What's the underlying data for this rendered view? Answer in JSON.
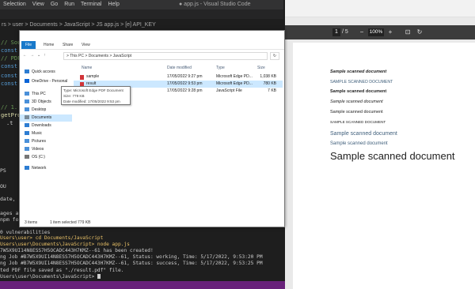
{
  "vscode": {
    "menu": [
      "Selection",
      "View",
      "Go",
      "Run",
      "Terminal",
      "Help"
    ],
    "window_title": "● app.js - Visual Studio Code",
    "breadcrumb": "rs > user > Documents > JavaScript > JS app.js > [e] API_KEY",
    "code_lines": [
      "// Sou",
      "const",
      "// PDF",
      "const",
      "const",
      "const",
      "// 1.",
      "getPro",
      ".t"
    ],
    "left_snippets": [
      "PS",
      "OU",
      "date, a",
      "ages an",
      "npm fo"
    ],
    "terminal": {
      "lines": [
        "0 vulnerabilities",
        "Users\\user> cd Documents/JavaScript",
        "Users\\user\\Documents\\JavaScript> node app.js",
        "7W5X9UI14N8ESS7H5OCADC443H7KMZ--61 has been created!",
        "ng Job #B7W5X9UI14N8ESS7H5OCADC443H7KMZ--61, Status: working, Time: 5/17/2022, 9:53:20 PM",
        "ng Job #B7W5X9UI14N8ESS7H5OCADC443H7KMZ--61, Status: success, Time: 5/17/2022, 9:53:25 PM",
        "ted PDF file saved as \"./result.pdf\" file.",
        "Users\\user\\Documents\\JavaScript> "
      ]
    }
  },
  "explorer": {
    "ribbon": {
      "file": "File",
      "tabs": [
        "Home",
        "Share",
        "View"
      ]
    },
    "address": "> This PC > Documents > JavaScript",
    "nav_items": [
      {
        "label": "Quick access",
        "icon": "star-icon",
        "color": "#2d7dd2"
      },
      {
        "label": "OneDrive - Personal",
        "icon": "cloud-icon",
        "color": "#0a64d6"
      },
      {
        "label": "This PC",
        "icon": "computer-icon",
        "color": "#4a90d9"
      },
      {
        "label": "3D Objects",
        "icon": "cube-icon",
        "color": "#4a90d9"
      },
      {
        "label": "Desktop",
        "icon": "desktop-icon",
        "color": "#4a90d9"
      },
      {
        "label": "Documents",
        "icon": "documents-icon",
        "color": "#7a8b99"
      },
      {
        "label": "Downloads",
        "icon": "download-icon",
        "color": "#2d7dd2"
      },
      {
        "label": "Music",
        "icon": "music-icon",
        "color": "#2d7dd2"
      },
      {
        "label": "Pictures",
        "icon": "pictures-icon",
        "color": "#4a90d9"
      },
      {
        "label": "Videos",
        "icon": "video-icon",
        "color": "#4a90d9"
      },
      {
        "label": "OS (C:)",
        "icon": "drive-icon",
        "color": "#777777"
      },
      {
        "label": "Network",
        "icon": "network-icon",
        "color": "#2d7dd2"
      }
    ],
    "columns": [
      "Name",
      "Date modified",
      "Type",
      "Size"
    ],
    "files": [
      {
        "name": "sample",
        "date": "17/05/2022 9:27 pm",
        "type": "Microsoft Edge PD...",
        "size": "1,038 KB",
        "icon_color": "#d13438"
      },
      {
        "name": "result",
        "date": "17/05/2022 9:53 pm",
        "type": "Microsoft Edge PD...",
        "size": "780 KB",
        "icon_color": "#d13438"
      },
      {
        "name": "app",
        "date": "17/05/2022 9:28 pm",
        "type": "JavaScript File",
        "size": "7 KB",
        "icon_color": "#555555"
      }
    ],
    "tooltip": [
      "Type: Microsoft Edge PDF Document",
      "Size: 779 KB",
      "Date modified: 17/05/2022 9:53 pm"
    ],
    "status": {
      "items": "3 items",
      "selected": "1 item selected  779 KB"
    }
  },
  "pdf": {
    "page_current": "1",
    "page_total": "/ 5",
    "zoom": "100%",
    "lines": [
      "Sample scanned document",
      "SAMPLE SCANNED DOCUMENT",
      "Sample scanned document",
      "Sample scanned document",
      "Sample scanned document",
      "SAMPLE SCANNED DOCUMENT",
      "Sample scanned document",
      "Sample scanned document",
      "Sample scanned document"
    ]
  },
  "colors": {
    "accent": "#1979ca",
    "status_bar": "#68217a",
    "selection": "#cce8ff"
  }
}
